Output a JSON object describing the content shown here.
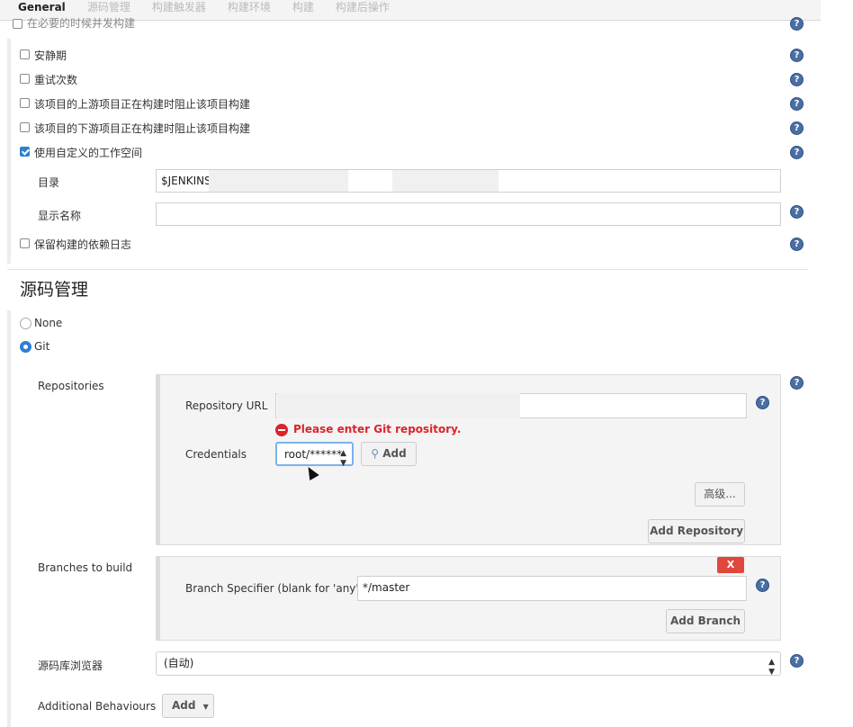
{
  "tabs": [
    "General",
    "源码管理",
    "构建触发器",
    "构建环境",
    "构建",
    "构建后操作"
  ],
  "general": {
    "cut_option": "在必要的时候并发构建",
    "options": [
      {
        "label": "安静期",
        "checked": false
      },
      {
        "label": "重试次数",
        "checked": false
      },
      {
        "label": "该项目的上游项目正在构建时阻止该项目构建",
        "checked": false
      },
      {
        "label": "该项目的下游项目正在构建时阻止该项目构建",
        "checked": false
      },
      {
        "label": "使用自定义的工作空间",
        "checked": true
      }
    ],
    "directory_label": "目录",
    "directory_value": "$JENKINS",
    "display_name_label": "显示名称",
    "display_name_value": "",
    "keep_logs_label": "保留构建的依赖日志"
  },
  "scm": {
    "title": "源码管理",
    "none_label": "None",
    "git_label": "Git",
    "repositories_label": "Repositories",
    "repo_url_label": "Repository URL",
    "repo_url_value": "",
    "error": "Please enter Git repository.",
    "credentials_label": "Credentials",
    "credentials_value": "root/******",
    "add_label": "Add",
    "advanced_label": "高级...",
    "add_repository_label": "Add Repository",
    "branches_label": "Branches to build",
    "delete_label": "X",
    "branch_specifier_label": "Branch Specifier (blank for 'any')",
    "branch_specifier_value": "*/master",
    "add_branch_label": "Add Branch",
    "browser_label": "源码库浏览器",
    "browser_value": "(自动)",
    "additional_label": "Additional Behaviours",
    "additional_add_label": "Add"
  },
  "help_glyph": "?",
  "colors": {
    "accent": "#2d7fd3",
    "error": "#d9252a",
    "help": "#4a6fa5"
  }
}
